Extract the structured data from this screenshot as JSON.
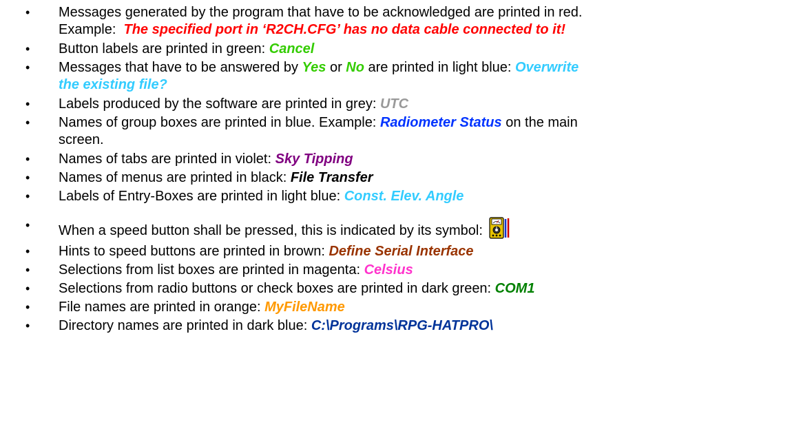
{
  "bullet_char": "•",
  "colors": {
    "red": "#ff0000",
    "green": "#33cc00",
    "light_blue": "#33ccff",
    "grey": "#999999",
    "blue": "#0033ff",
    "violet": "#800080",
    "black": "#000000",
    "brown": "#993300",
    "magenta": "#ff33cc",
    "dark_green": "#008000",
    "orange": "#ff9900",
    "dark_blue": "#003399"
  },
  "items": [
    {
      "line1": "Messages generated by the program that have to be acknowledged are printed in red.",
      "line2_prefix": "Example:  ",
      "example": "The specified port in ‘R2CH.CFG’ has no data cable connected to it!"
    },
    {
      "text": "Button labels are printed in green: ",
      "example": "Cancel"
    },
    {
      "part1": "Messages that have to be answered by ",
      "yes": "Yes",
      "part2": " or ",
      "no": "No",
      "part3": " are printed in light blue: ",
      "example_a": "Overwrite",
      "example_b": "the existing file?"
    },
    {
      "text": "Labels produced by the software are printed in grey: ",
      "example": "UTC"
    },
    {
      "text": "Names of group boxes are printed in blue. Example: ",
      "example": "Radiometer Status",
      "suffix": " on the main",
      "line2": "screen."
    },
    {
      "text": "Names of tabs are printed in violet: ",
      "example": "Sky Tipping"
    },
    {
      "text": "Names of menus are printed in black: ",
      "example": "File Transfer"
    },
    {
      "text": "Labels of Entry-Boxes are printed in light blue: ",
      "example": "Const. Elev. Angle"
    },
    {
      "text": "When a speed button shall be pressed, this is indicated by its symbol: ",
      "icon": "speed-button-icon"
    },
    {
      "text": "Hints to speed buttons are printed in brown: ",
      "example": "Define Serial Interface"
    },
    {
      "text": "Selections from list boxes are printed in magenta: ",
      "example": "Celsius"
    },
    {
      "text": "Selections from radio buttons or check boxes are printed in dark green: ",
      "example": "COM1"
    },
    {
      "text": "File names are printed in orange: ",
      "example": "MyFileName"
    },
    {
      "text": "Directory names are printed in dark blue: ",
      "example": "C:\\Programs\\RPG-HATPRO\\"
    }
  ]
}
